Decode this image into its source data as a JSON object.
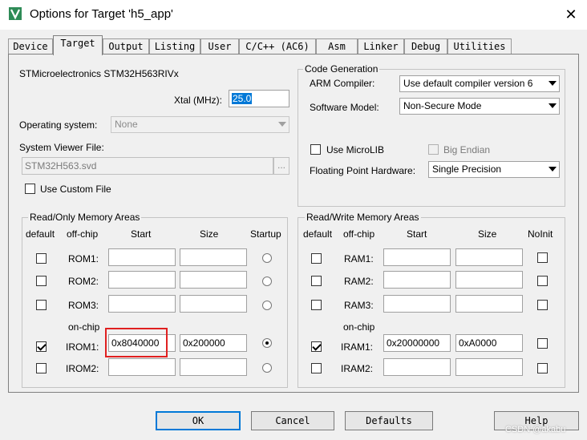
{
  "window": {
    "title": "Options for Target 'h5_app'",
    "close_glyph": "✕",
    "app_icon": "keil-uvision-icon"
  },
  "tabs": [
    {
      "label": "Device",
      "active": false
    },
    {
      "label": "Target",
      "active": true
    },
    {
      "label": "Output",
      "active": false
    },
    {
      "label": "Listing",
      "active": false
    },
    {
      "label": "User",
      "active": false
    },
    {
      "label": "C/C++ (AC6)",
      "active": false
    },
    {
      "label": "Asm",
      "active": false
    },
    {
      "label": "Linker",
      "active": false
    },
    {
      "label": "Debug",
      "active": false
    },
    {
      "label": "Utilities",
      "active": false
    }
  ],
  "target": {
    "device_name": "STMicroelectronics STM32H563RIVx",
    "xtal_label": "Xtal (MHz):",
    "xtal_value": "25.0",
    "os_label": "Operating system:",
    "os_value": "None",
    "svd_label": "System Viewer File:",
    "svd_value": "STM32H563.svd",
    "browse_label": "...",
    "custom_file_label": "Use Custom File",
    "custom_file_checked": false
  },
  "codegen": {
    "title": "Code Generation",
    "arm_compiler_label": "ARM Compiler:",
    "arm_compiler_value": "Use default compiler version 6",
    "software_model_label": "Software Model:",
    "software_model_value": "Non-Secure Mode",
    "microlib_label": "Use MicroLIB",
    "microlib_checked": false,
    "big_endian_label": "Big Endian",
    "big_endian_checked": false,
    "fp_label": "Floating Point Hardware:",
    "fp_value": "Single Precision"
  },
  "ro_memory": {
    "title": "Read/Only Memory Areas",
    "headers": {
      "default": "default",
      "offchip": "off-chip",
      "start": "Start",
      "size": "Size",
      "startup": "Startup"
    },
    "onchip_label": "on-chip",
    "rows": [
      {
        "name": "ROM1:",
        "default": false,
        "start": "",
        "size": "",
        "startup": false
      },
      {
        "name": "ROM2:",
        "default": false,
        "start": "",
        "size": "",
        "startup": false
      },
      {
        "name": "ROM3:",
        "default": false,
        "start": "",
        "size": "",
        "startup": false
      },
      {
        "name": "IROM1:",
        "default": true,
        "start": "0x8040000",
        "size": "0x200000",
        "startup": true
      },
      {
        "name": "IROM2:",
        "default": false,
        "start": "",
        "size": "",
        "startup": false
      }
    ]
  },
  "rw_memory": {
    "title": "Read/Write Memory Areas",
    "headers": {
      "default": "default",
      "offchip": "off-chip",
      "start": "Start",
      "size": "Size",
      "noinit": "NoInit"
    },
    "onchip_label": "on-chip",
    "rows": [
      {
        "name": "RAM1:",
        "default": false,
        "start": "",
        "size": "",
        "noinit": false
      },
      {
        "name": "RAM2:",
        "default": false,
        "start": "",
        "size": "",
        "noinit": false
      },
      {
        "name": "RAM3:",
        "default": false,
        "start": "",
        "size": "",
        "noinit": false
      },
      {
        "name": "IRAM1:",
        "default": true,
        "start": "0x20000000",
        "size": "0xA0000",
        "noinit": false
      },
      {
        "name": "IRAM2:",
        "default": false,
        "start": "",
        "size": "",
        "noinit": false
      }
    ]
  },
  "buttons": {
    "ok": "OK",
    "cancel": "Cancel",
    "defaults": "Defaults",
    "help": "Help"
  },
  "watermark": "CSDN @akabu",
  "colors": {
    "highlight": "#e02020",
    "selection": "#0078d7"
  }
}
